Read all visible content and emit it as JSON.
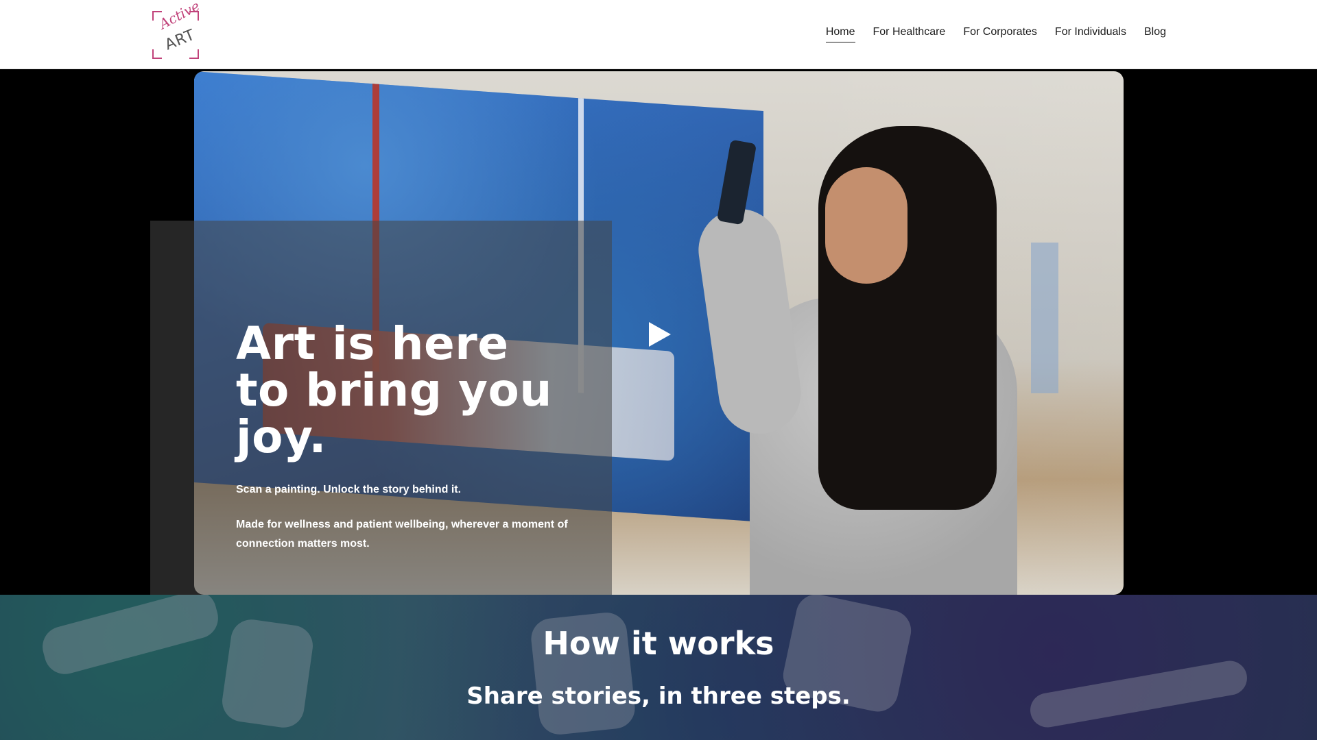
{
  "header": {
    "logo": {
      "top_word": "Active",
      "bottom_word": "ART"
    },
    "nav": [
      {
        "label": "Home",
        "active": true
      },
      {
        "label": "For Healthcare",
        "active": false
      },
      {
        "label": "For Corporates",
        "active": false
      },
      {
        "label": "For Individuals",
        "active": false
      },
      {
        "label": "Blog",
        "active": false
      }
    ]
  },
  "hero": {
    "headline": "Art is here to bring you joy.",
    "subtitle_1": "Scan a painting. Unlock the story behind it.",
    "subtitle_2": "Made for wellness and patient wellbeing, wherever a moment of connection matters most.",
    "play_icon": "play-icon"
  },
  "how_it_works": {
    "title": "How it works",
    "subtitle": "Share stories, in three steps."
  },
  "colors": {
    "brand_pink": "#c1427a",
    "nav_text": "#1a1a1a",
    "hero_overlay": "#464646"
  }
}
